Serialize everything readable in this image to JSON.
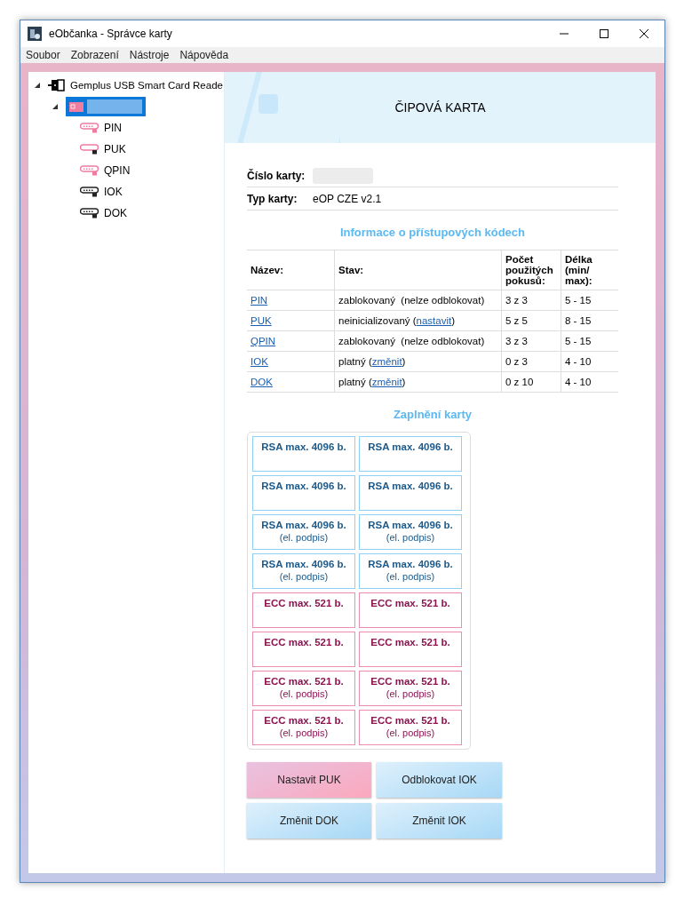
{
  "window": {
    "title": "eObčanka - Správce karty"
  },
  "menu": [
    "Soubor",
    "Zobrazení",
    "Nástroje",
    "Nápověda"
  ],
  "tree": {
    "label": "Gemplus USB Smart Card Reade",
    "expanded": true,
    "children": [
      {
        "selected": true,
        "expanded": true,
        "children": [
          {
            "label": "PIN",
            "kind": "blocked",
            "selected": false
          },
          {
            "label": "PUK",
            "kind": "uninitialized",
            "selected": false
          },
          {
            "label": "QPIN",
            "kind": "blocked",
            "selected": false
          },
          {
            "label": "IOK",
            "kind": "valid",
            "selected": false
          },
          {
            "label": "DOK",
            "kind": "valid",
            "selected": false
          }
        ]
      }
    ]
  },
  "header": {
    "title": "ČIPOVÁ KARTA"
  },
  "info": [
    {
      "label": "Číslo karty:",
      "kind": "hidden"
    },
    {
      "label": "Typ karty:",
      "kind": "text",
      "value": "eOP CZE v2.1"
    }
  ],
  "codes": {
    "title": "Informace o přístupových kódech",
    "columns": [
      "Název:",
      "Stav:",
      "Počet použitých pokusů:",
      "Délka (min/ max):"
    ],
    "rows": [
      {
        "name": "PIN",
        "status": [
          {
            "text": "zablokovaný  (nelze odblokovat)",
            "link": false
          }
        ],
        "attempts": "3 z 3",
        "length": "5 - 15"
      },
      {
        "name": "PUK",
        "status": [
          {
            "text": "neinicializovaný (",
            "link": false
          },
          {
            "text": "nastavit",
            "link": true
          },
          {
            "text": ")",
            "link": false
          }
        ],
        "attempts": "5 z 5",
        "length": "8 - 15"
      },
      {
        "name": "QPIN",
        "status": [
          {
            "text": "zablokovaný  (nelze odblokovat)",
            "link": false
          }
        ],
        "attempts": "3 z 3",
        "length": "5 - 15"
      },
      {
        "name": "IOK",
        "status": [
          {
            "text": "platný (",
            "link": false
          },
          {
            "text": "změnit",
            "link": true
          },
          {
            "text": ")",
            "link": false
          }
        ],
        "attempts": "0 z 3",
        "length": "4 - 10"
      },
      {
        "name": "DOK",
        "status": [
          {
            "text": "platný (",
            "link": false
          },
          {
            "text": "změnit",
            "link": true
          },
          {
            "text": ")",
            "link": false
          }
        ],
        "attempts": "0 z 10",
        "length": "4 - 10"
      }
    ]
  },
  "capacity": {
    "title": "Zaplnění karty",
    "slots": [
      {
        "kind": "rsa",
        "label": "RSA max. 4096 b."
      },
      {
        "kind": "rsa",
        "label": "RSA max. 4096 b."
      },
      {
        "kind": "rsa",
        "label": "RSA max. 4096 b."
      },
      {
        "kind": "rsa",
        "label": "RSA max. 4096 b."
      },
      {
        "kind": "rsa",
        "label": "RSA max. 4096 b.",
        "note": "(el. podpis)"
      },
      {
        "kind": "rsa",
        "label": "RSA max. 4096 b.",
        "note": "(el. podpis)"
      },
      {
        "kind": "rsa",
        "label": "RSA max. 4096 b.",
        "note": "(el. podpis)"
      },
      {
        "kind": "rsa",
        "label": "RSA max. 4096 b.",
        "note": "(el. podpis)"
      },
      {
        "kind": "ecc",
        "label": "ECC max. 521 b."
      },
      {
        "kind": "ecc",
        "label": "ECC max. 521 b."
      },
      {
        "kind": "ecc",
        "label": "ECC max. 521 b."
      },
      {
        "kind": "ecc",
        "label": "ECC max. 521 b."
      },
      {
        "kind": "ecc",
        "label": "ECC max. 521 b.",
        "note": "(el. podpis)"
      },
      {
        "kind": "ecc",
        "label": "ECC max. 521 b.",
        "note": "(el. podpis)"
      },
      {
        "kind": "ecc",
        "label": "ECC max. 521 b.",
        "note": "(el. podpis)"
      },
      {
        "kind": "ecc",
        "label": "ECC max. 521 b.",
        "note": "(el. podpis)"
      }
    ]
  },
  "buttons": [
    {
      "label": "Nastavit PUK",
      "kind": "pink"
    },
    {
      "label": "Odblokovat IOK",
      "kind": "blue"
    },
    {
      "label": "Změnit DOK",
      "kind": "blue"
    },
    {
      "label": "Změnit IOK",
      "kind": "blue"
    }
  ]
}
